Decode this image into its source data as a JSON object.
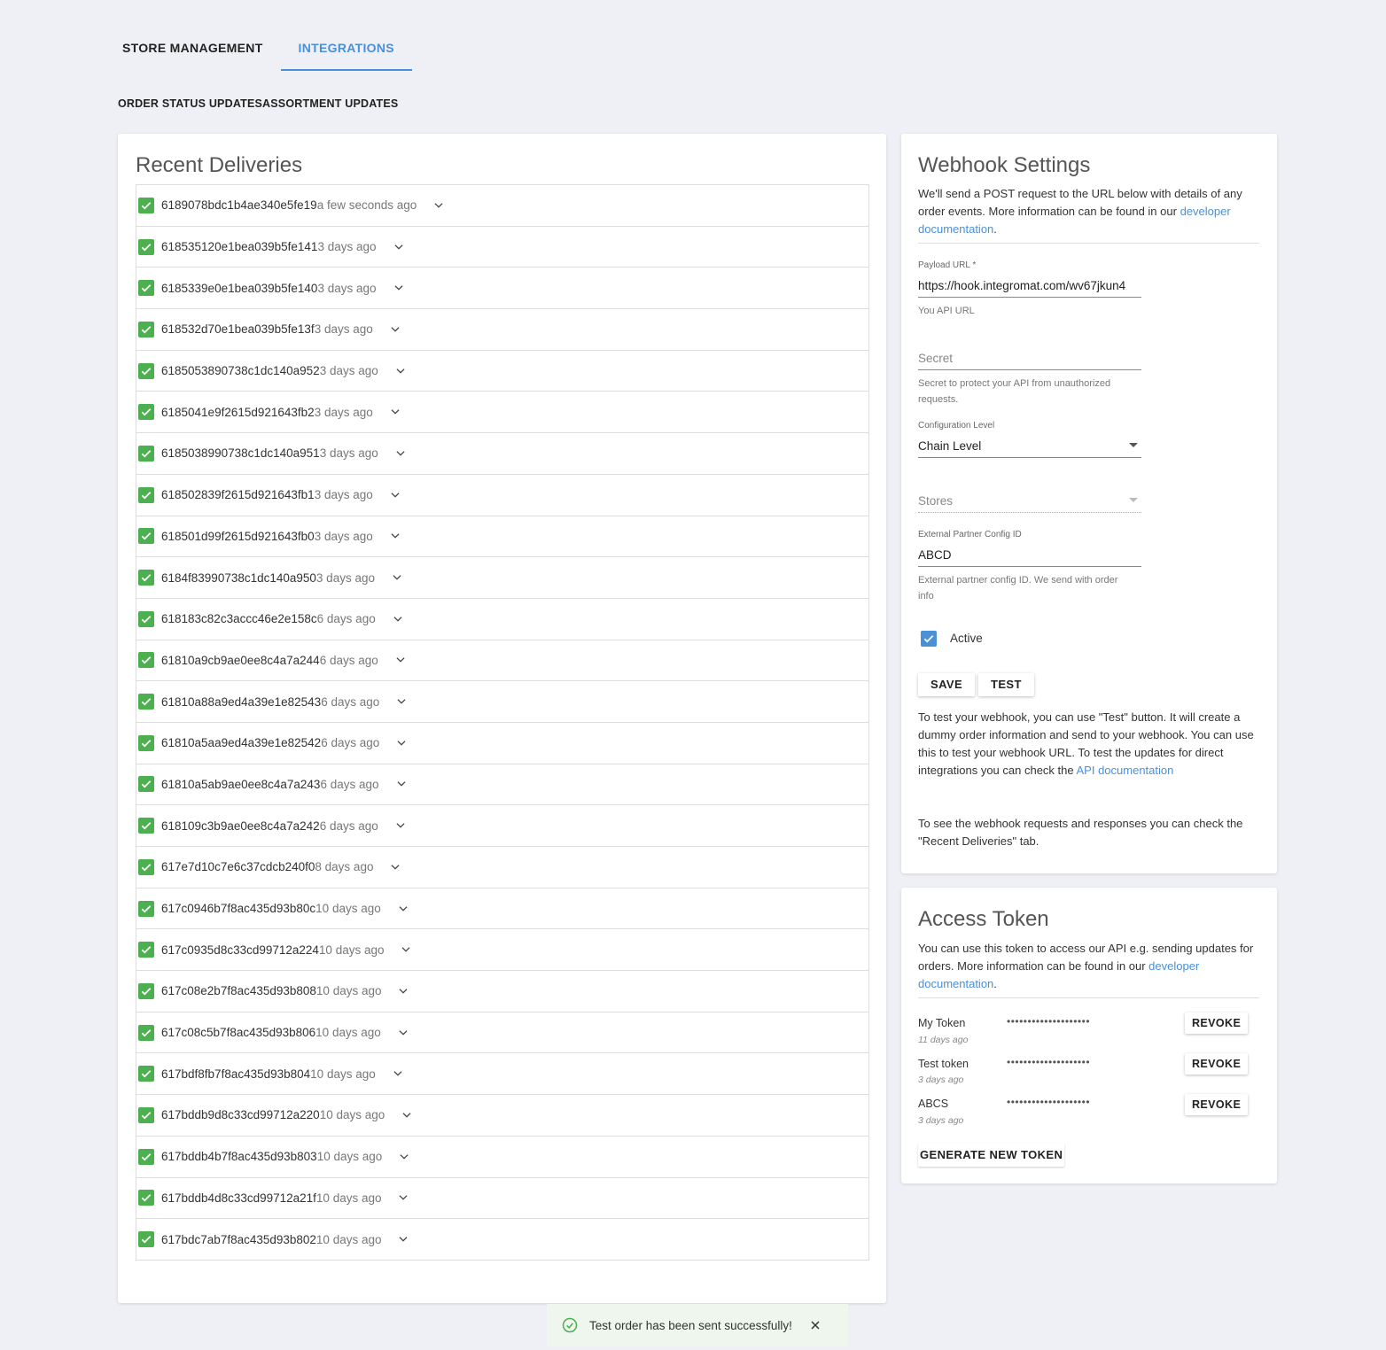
{
  "tabs": [
    {
      "label": "STORE MANAGEMENT",
      "active": false
    },
    {
      "label": "INTEGRATIONS",
      "active": true
    }
  ],
  "subtabs": [
    "ORDER STATUS UPDATES",
    "ASSORTMENT UPDATES"
  ],
  "deliveries": {
    "title": "Recent Deliveries",
    "items": [
      {
        "id": "6189078bdc1b4ae340e5fe19",
        "time": "a few seconds ago"
      },
      {
        "id": "618535120e1bea039b5fe141",
        "time": "3 days ago"
      },
      {
        "id": "6185339e0e1bea039b5fe140",
        "time": "3 days ago"
      },
      {
        "id": "618532d70e1bea039b5fe13f",
        "time": "3 days ago"
      },
      {
        "id": "6185053890738c1dc140a952",
        "time": "3 days ago"
      },
      {
        "id": "6185041e9f2615d921643fb2",
        "time": "3 days ago"
      },
      {
        "id": "6185038990738c1dc140a951",
        "time": "3 days ago"
      },
      {
        "id": "618502839f2615d921643fb1",
        "time": "3 days ago"
      },
      {
        "id": "618501d99f2615d921643fb0",
        "time": "3 days ago"
      },
      {
        "id": "6184f83990738c1dc140a950",
        "time": "3 days ago"
      },
      {
        "id": "618183c82c3accc46e2e158c",
        "time": "6 days ago"
      },
      {
        "id": "61810a9cb9ae0ee8c4a7a244",
        "time": "6 days ago"
      },
      {
        "id": "61810a88a9ed4a39e1e82543",
        "time": "6 days ago"
      },
      {
        "id": "61810a5aa9ed4a39e1e82542",
        "time": "6 days ago"
      },
      {
        "id": "61810a5ab9ae0ee8c4a7a243",
        "time": "6 days ago"
      },
      {
        "id": "618109c3b9ae0ee8c4a7a242",
        "time": "6 days ago"
      },
      {
        "id": "617e7d10c7e6c37cdcb240f0",
        "time": "8 days ago"
      },
      {
        "id": "617c0946b7f8ac435d93b80c",
        "time": "10 days ago"
      },
      {
        "id": "617c0935d8c33cd99712a224",
        "time": "10 days ago"
      },
      {
        "id": "617c08e2b7f8ac435d93b808",
        "time": "10 days ago"
      },
      {
        "id": "617c08c5b7f8ac435d93b806",
        "time": "10 days ago"
      },
      {
        "id": "617bdf8fb7f8ac435d93b804",
        "time": "10 days ago"
      },
      {
        "id": "617bddb9d8c33cd99712a220",
        "time": "10 days ago"
      },
      {
        "id": "617bddb4b7f8ac435d93b803",
        "time": "10 days ago"
      },
      {
        "id": "617bddb4d8c33cd99712a21f",
        "time": "10 days ago"
      },
      {
        "id": "617bdc7ab7f8ac435d93b802",
        "time": "10 days ago"
      }
    ]
  },
  "webhook": {
    "title": "Webhook Settings",
    "intro": "We'll send a POST request to the URL below with details of any order events. More information can be found in our",
    "intro_link": "developer documentation",
    "intro_end": ".",
    "payload_label": "Payload URL *",
    "payload_value": "https://hook.integromat.com/wv67jkun4",
    "payload_hint": "You API URL",
    "secret_placeholder": "Secret",
    "secret_hint": "Secret to protect your API from unauthorized requests.",
    "config_label": "Configuration Level",
    "config_value": "Chain Level",
    "stores_placeholder": "Stores",
    "partner_label": "External Partner Config ID",
    "partner_value": "ABCD",
    "partner_hint": "External partner config ID. We send with order info",
    "active_label": "Active",
    "active_checked": true,
    "save_label": "SAVE",
    "test_label": "TEST",
    "help1": "To test your webhook, you can use \"Test\" button. It will create a dummy order information and send to your webhook. You can use this to test your webhook URL. To test the updates for direct integrations you can check the",
    "help1_link": "API documentation",
    "help2": "To see the webhook requests and responses you can check the \"Recent Deliveries\" tab."
  },
  "token": {
    "title": "Access Token",
    "intro": "You can use this token to access our API e.g. sending updates for orders. More information can be found in our",
    "intro_link": "developer documentation",
    "intro_end": ".",
    "items": [
      {
        "name": "My Token",
        "ago": "11 days ago",
        "mask": "••••••••••••••••••••",
        "revoke": "REVOKE"
      },
      {
        "name": "Test token",
        "ago": "3 days ago",
        "mask": "••••••••••••••••••••",
        "revoke": "REVOKE"
      },
      {
        "name": "ABCS",
        "ago": "3 days ago",
        "mask": "••••••••••••••••••••",
        "revoke": "REVOKE"
      }
    ],
    "generate_label": "GENERATE NEW TOKEN"
  },
  "toast": {
    "message": "Test order has been sent successfully!"
  },
  "colors": {
    "accent": "#4a90d9",
    "success": "#4caf50",
    "background": "#eef0f5"
  },
  "icons": {
    "delivery_status": "check-icon",
    "expand": "chevron-down-icon",
    "toast_status": "check-circle-icon",
    "toast_close": "close-icon"
  }
}
